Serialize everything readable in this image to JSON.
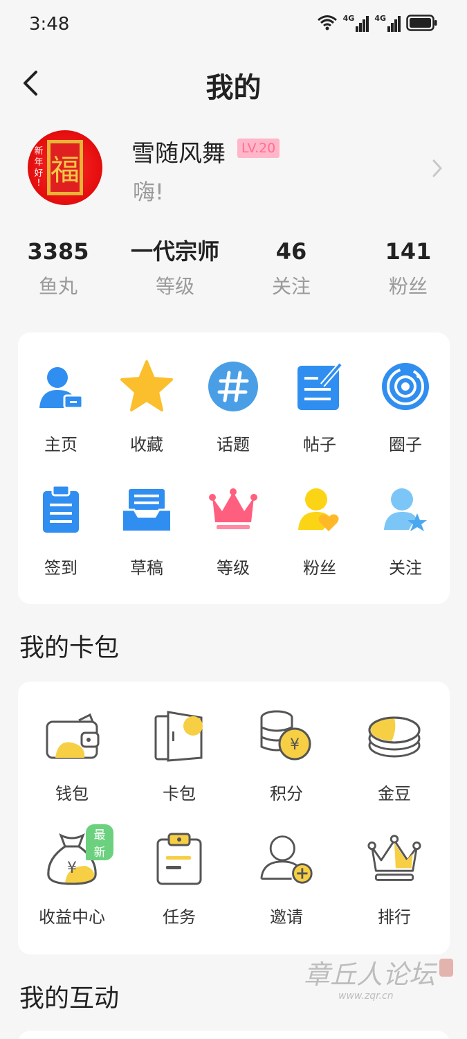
{
  "status": {
    "time": "3:48",
    "net1": "4G",
    "net2": "4G"
  },
  "header": {
    "title": "我的"
  },
  "profile": {
    "avatar_text": [
      "新",
      "年",
      "好",
      "!",
      "福"
    ],
    "username": "雪随风舞",
    "level": "LV.20",
    "bio": "嗨!"
  },
  "stats": [
    {
      "value": "3385",
      "label": "鱼丸"
    },
    {
      "value": "一代宗师",
      "label": "等级"
    },
    {
      "value": "46",
      "label": "关注"
    },
    {
      "value": "141",
      "label": "粉丝"
    }
  ],
  "menu": [
    {
      "label": "主页",
      "icon": "user-card-icon"
    },
    {
      "label": "收藏",
      "icon": "star-icon"
    },
    {
      "label": "话题",
      "icon": "hashtag-icon"
    },
    {
      "label": "帖子",
      "icon": "post-edit-icon"
    },
    {
      "label": "圈子",
      "icon": "orbit-icon"
    },
    {
      "label": "签到",
      "icon": "clipboard-icon"
    },
    {
      "label": "草稿",
      "icon": "drafts-tray-icon"
    },
    {
      "label": "等级",
      "icon": "crown-icon"
    },
    {
      "label": "粉丝",
      "icon": "fans-heart-icon"
    },
    {
      "label": "关注",
      "icon": "follow-star-icon"
    }
  ],
  "wallet_section": {
    "title": "我的卡包",
    "items": [
      {
        "label": "钱包",
        "icon": "wallet-icon"
      },
      {
        "label": "卡包",
        "icon": "card-holder-icon"
      },
      {
        "label": "积分",
        "icon": "coins-yen-icon"
      },
      {
        "label": "金豆",
        "icon": "gold-beans-icon"
      },
      {
        "label": "收益中心",
        "icon": "money-bag-icon",
        "badge": "最新"
      },
      {
        "label": "任务",
        "icon": "task-clipboard-icon"
      },
      {
        "label": "邀请",
        "icon": "invite-user-icon"
      },
      {
        "label": "排行",
        "icon": "ranking-crown-icon"
      }
    ]
  },
  "interaction_section": {
    "title": "我的互动"
  },
  "watermark": {
    "text": "章丘人论坛",
    "url": "www.zqr.cn"
  },
  "colors": {
    "accent_blue": "#2f8ef0",
    "accent_yellow": "#f7cf45",
    "pink": "#ff6e94",
    "green_badge": "#6cd17e"
  }
}
